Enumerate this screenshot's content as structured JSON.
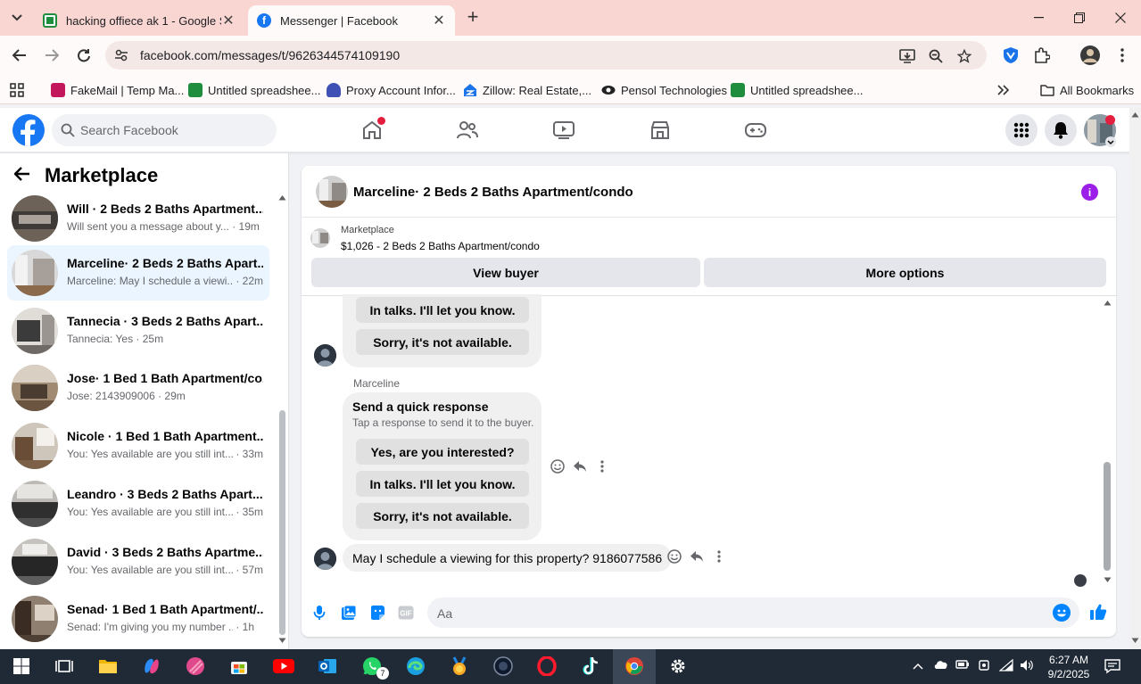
{
  "browser": {
    "tabs": [
      {
        "title": "hacking offiece ak 1 - Google Sh",
        "favicon": "google-sheets-icon",
        "active": false
      },
      {
        "title": "Messenger | Facebook",
        "favicon": "facebook-icon",
        "active": true
      }
    ],
    "url": "facebook.com/messages/t/9626344574109190",
    "bookmarks": [
      {
        "label": "FakeMail | Temp Ma...",
        "icon": "fakemail-icon",
        "color": "#c2185b"
      },
      {
        "label": "Untitled spreadshee...",
        "icon": "google-sheets-icon",
        "color": "#1e8e3e"
      },
      {
        "label": "Proxy Account Infor...",
        "icon": "proxy-icon",
        "color": "#3f51b5"
      },
      {
        "label": "Zillow: Real Estate,...",
        "icon": "zillow-icon",
        "color": "#1a73e8"
      },
      {
        "label": "Pensol Technologies",
        "icon": "pensol-icon",
        "color": "#222222"
      },
      {
        "label": "Untitled spreadshee...",
        "icon": "google-sheets-icon",
        "color": "#1e8e3e"
      }
    ],
    "all_bookmarks": "All Bookmarks"
  },
  "facebook": {
    "search_placeholder": "Search Facebook",
    "brand_color": "#1877f2"
  },
  "sidebar": {
    "title": "Marketplace",
    "conversations": [
      {
        "name": "Will · 2 Beds 2 Baths Apartment...",
        "preview": "Will sent you a message about y...",
        "time": " · 19m",
        "selected": false
      },
      {
        "name": "Marceline· 2 Beds 2 Baths Apart...",
        "preview": "Marceline: May I schedule a viewi...",
        "time": " · 22m",
        "selected": true
      },
      {
        "name": "Tannecia · 3 Beds 2 Baths Apart...",
        "preview": "Tannecia: Yes",
        "time": " · 25m",
        "selected": false
      },
      {
        "name": "Jose· 1 Bed 1 Bath Apartment/co...",
        "preview": "Jose: 2143909006",
        "time": " · 29m",
        "selected": false
      },
      {
        "name": "Nicole · 1 Bed 1 Bath Apartment....",
        "preview": "You: Yes available are you still int...",
        "time": " · 33m",
        "selected": false
      },
      {
        "name": "Leandro · 3 Beds 2 Baths Apart...",
        "preview": "You: Yes available are you still int...",
        "time": " · 35m",
        "selected": false
      },
      {
        "name": "David · 3 Beds 2 Baths Apartme...",
        "preview": "You: Yes available are you still int...",
        "time": " · 57m",
        "selected": false
      },
      {
        "name": "Senad· 1 Bed 1 Bath Apartment/...",
        "preview": "Senad: I'm giving you my number ...",
        "time": " · 1h",
        "selected": false
      }
    ]
  },
  "chat": {
    "title": "Marceline· 2 Beds 2 Baths Apartment/condo",
    "listing_label": "Marketplace",
    "listing_price": "$1,026 - 2 Beds 2 Baths Apartment/condo",
    "view_buyer": "View buyer",
    "more_options": "More options",
    "card1": {
      "responses": [
        "In talks. I'll let you know.",
        "Sorry, it's not available."
      ]
    },
    "sender_name": "Marceline",
    "card2": {
      "title": "Send a quick response",
      "subtitle": "Tap a response to send it to the buyer.",
      "responses": [
        "Yes, are you interested?",
        "In talks. I'll let you know.",
        "Sorry, it's not available."
      ]
    },
    "message": "May I schedule a viewing for this property? 9186077586",
    "composer_placeholder": "Aa",
    "accent_color": "#0084ff"
  },
  "taskbar": {
    "time": "6:27 AM",
    "date": "9/2/2025",
    "whatsapp_badge": "7"
  }
}
